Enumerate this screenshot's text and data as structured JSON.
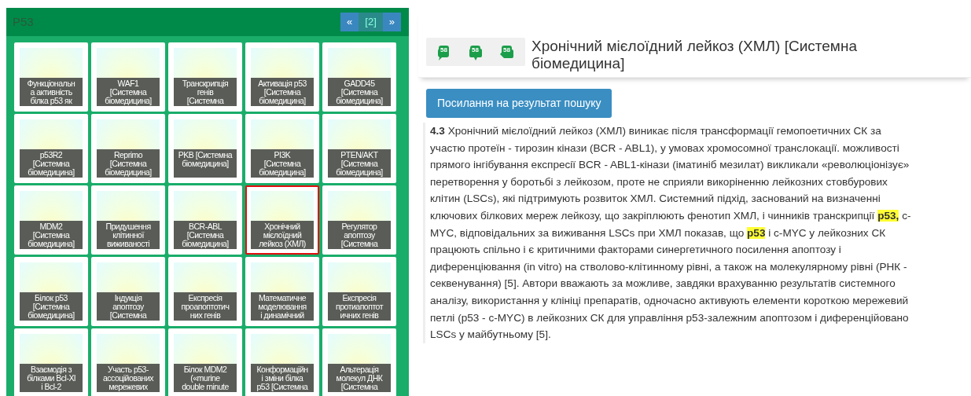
{
  "panel": {
    "title": "P53",
    "pager": [
      {
        "label": "«",
        "kind": "prev"
      },
      {
        "label": "[2]",
        "kind": "current"
      },
      {
        "label": "»",
        "kind": "next"
      }
    ],
    "tiles": [
      {
        "lines": [
          "Функціональн",
          "а активність",
          "білка p53 як"
        ],
        "selected": false
      },
      {
        "lines": [
          "WAF1",
          "[Системна",
          "біомедицина]"
        ],
        "selected": false
      },
      {
        "lines": [
          "Транскрипція",
          "генів",
          "[Системна"
        ],
        "selected": false
      },
      {
        "lines": [
          "Активація p53",
          "[Системна",
          "біомедицина]"
        ],
        "selected": false
      },
      {
        "lines": [
          "GADD45",
          "[Системна",
          "біомедицина]"
        ],
        "selected": false
      },
      {
        "lines": [
          "p53R2",
          "[Системна",
          "біомедицина]"
        ],
        "selected": false
      },
      {
        "lines": [
          "Reprimo",
          "[Системна",
          "біомедицина]"
        ],
        "selected": false
      },
      {
        "lines": [
          "PKB [Системна",
          "біомедицина]"
        ],
        "selected": false
      },
      {
        "lines": [
          "PI3K",
          "[Системна",
          "біомедицина]"
        ],
        "selected": false
      },
      {
        "lines": [
          "PTEN/AKT",
          "[Системна",
          "біомедицина]"
        ],
        "selected": false
      },
      {
        "lines": [
          "MDM2",
          "[Системна",
          "біомедицина]"
        ],
        "selected": false
      },
      {
        "lines": [
          "Придушення",
          "клітинної",
          "виживаності"
        ],
        "selected": false
      },
      {
        "lines": [
          "BCR-ABL",
          "[Системна",
          "біомедицина]"
        ],
        "selected": false
      },
      {
        "lines": [
          "Хронічний",
          "мієлоїдний",
          "лейкоз (ХМЛ)"
        ],
        "selected": true
      },
      {
        "lines": [
          "Регулятор",
          "апоптозу",
          "[Системна"
        ],
        "selected": false
      },
      {
        "lines": [
          "Білок p53",
          "[Системна",
          "біомедицина]"
        ],
        "selected": false
      },
      {
        "lines": [
          "Індукція",
          "апоптозу",
          "[Системна"
        ],
        "selected": false
      },
      {
        "lines": [
          "Експресія",
          "проапоптотич",
          "них генів"
        ],
        "selected": false
      },
      {
        "lines": [
          "Математичне",
          "моделювання",
          "і динамічний"
        ],
        "selected": false
      },
      {
        "lines": [
          "Експресія",
          "протиапоптот",
          "ичних генів"
        ],
        "selected": false
      },
      {
        "lines": [
          "Взаємодія з",
          "білками Bcl-Xl",
          "і Bcl-2"
        ],
        "selected": false
      },
      {
        "lines": [
          "Участь p53-",
          "ассоційованих",
          "мережевих"
        ],
        "selected": false
      },
      {
        "lines": [
          "Білок MDM2",
          "(«murine",
          "double minute"
        ],
        "selected": false
      },
      {
        "lines": [
          "Конформаційн",
          "і зміни білка",
          "p53 [Системна"
        ],
        "selected": false
      },
      {
        "lines": [
          "Альтерація",
          "молекул ДНК",
          "[Системна"
        ],
        "selected": false
      }
    ]
  },
  "article": {
    "actions": [
      {
        "kind": "comment",
        "count": "58"
      },
      {
        "kind": "question",
        "count": "58"
      },
      {
        "kind": "reply",
        "count": "58"
      }
    ],
    "title": "Хронічний мієлоїдний лейкоз (ХМЛ) [Системна біомедицина]",
    "result_button": "Посилання на результат пошуку",
    "section_number": "4.3",
    "lines": [
      "Хронічний мієлоїдний лейкоз (ХМЛ) виникає після трансформації гемопоетичних СК за",
      "участю протеїн - тирозин кінази (BCR - ABL1), у умовах хромосомної транслокації. можливості",
      "прямого інгібування експресії BCR - ABL1-кінази (іматиніб мезилат) викликали «революціонізує»",
      "перетворення у боротьбі з лейкозом, проте не сприяли викоріненню лейкозних стовбурових",
      "клітин (LSCs), які підтримують розвиток ХМЛ. Системний підхід, заснований на визначенні",
      "ключових білкових мереж лейкозу, що закріплюють фенотип ХМЛ, і чинників транскрипції **p53,** с-",
      "MYC, відповідальних за виживання LSCs при ХМЛ показав, що **p53** і с-MYC у лейкозних СК",
      "працюють спільно і є критичними факторами синергетичного посилення апоптозу і",
      "диференціювання (in vitro) на стволово-клітинному рівні, а також на молекулярному рівні (РНК -",
      "секвенування) [5]. Автори вважають за можливе, завдяки врахуванню результатів системного",
      "аналізу, використання у клініці препаратів, одночасно активують елементи короткою мережевий",
      "петлі (p53 - c-MYC) в лейкозних СК для управління p53-залежним апоптозом і диференційовано",
      "LSCs у майбутньому [5]."
    ]
  }
}
